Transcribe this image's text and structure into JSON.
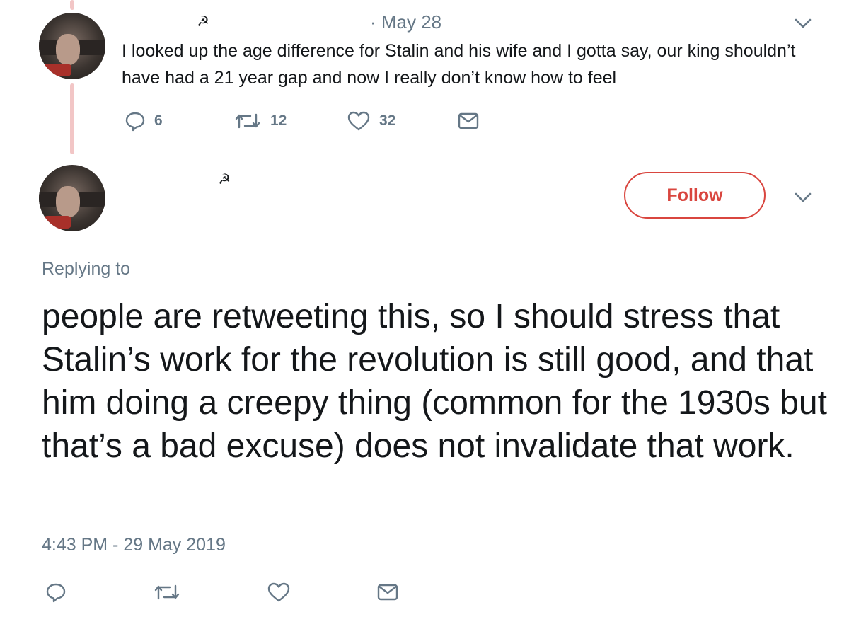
{
  "tweet1": {
    "emblem": "☭",
    "date": "· May 28",
    "text": "I looked up the age difference for Stalin and his wife and I gotta say, our king shouldn’t have had a 21 year gap and now I really don’t know how to feel",
    "replies": "6",
    "retweets": "12",
    "likes": "32"
  },
  "tweet2": {
    "emblem": "☭",
    "follow_label": "Follow",
    "replying_to": "Replying to",
    "text": "people are retweeting this, so I should stress that Stalin’s work for the revolution is still good, and that him doing a creepy thing (common for the 1930s but that’s a bad excuse) does not invalidate that work.",
    "timestamp": "4:43 PM - 29 May 2019"
  },
  "colors": {
    "accent": "#d9463f",
    "muted": "#657786",
    "text": "#14171a",
    "thread": "#f2c6c6"
  },
  "icons": [
    "reply-icon",
    "retweet-icon",
    "like-icon",
    "message-icon",
    "chevron-down-icon",
    "avatar"
  ]
}
